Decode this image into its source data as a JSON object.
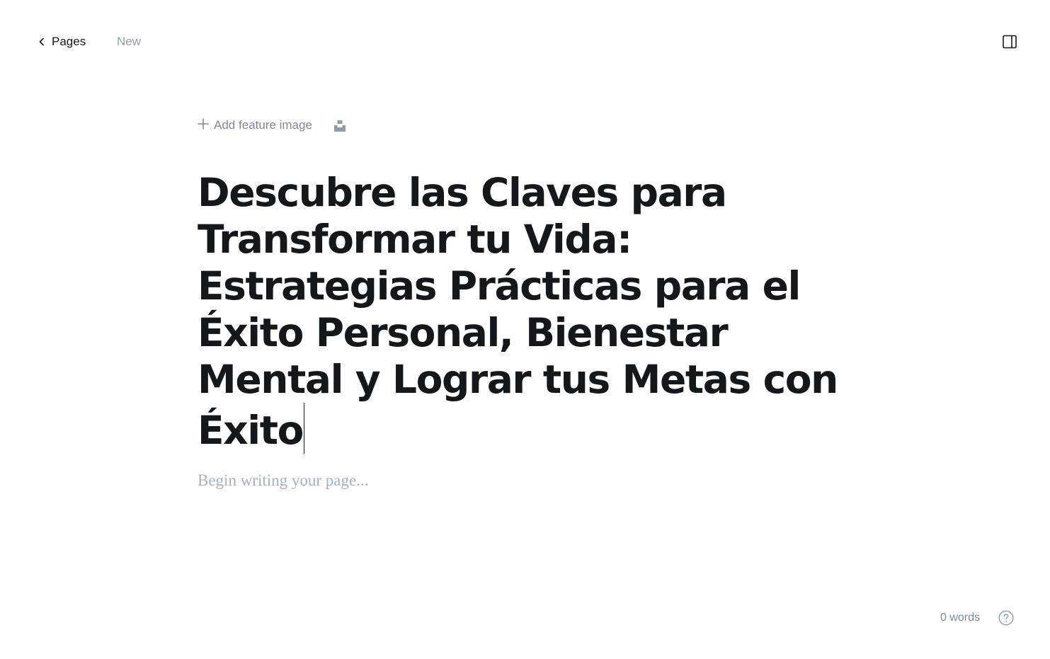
{
  "header": {
    "back_label": "Pages",
    "status": "New",
    "back_icon": "chevron-left-icon",
    "sidebar_icon": "sidebar-panel-icon"
  },
  "editor": {
    "add_feature_image_label": "Add feature image",
    "add_icon": "plus-icon",
    "unsplash_icon": "unsplash-icon",
    "title": "Descubre las Claves para Transformar tu Vida: Estrategias Prácticas para el Éxito Personal, Bienestar Mental y Lograr tus Metas con Éxito",
    "body_placeholder": "Begin writing your page..."
  },
  "footer": {
    "word_count": "0 words",
    "help_icon": "question-circle-icon"
  },
  "colors": {
    "text_primary": "#15171a",
    "text_muted": "#8e9cac",
    "placeholder": "#a6b2be",
    "background": "#ffffff"
  }
}
